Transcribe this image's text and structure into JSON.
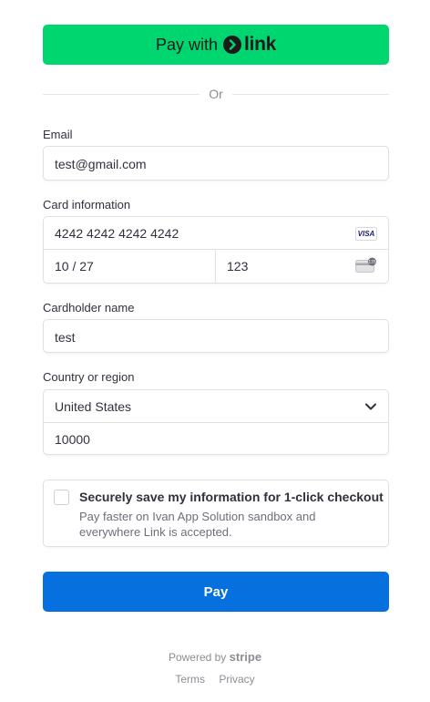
{
  "link_button": {
    "prefix": "Pay with",
    "brand": "link",
    "background": "#00d66f"
  },
  "divider_text": "Or",
  "email": {
    "label": "Email",
    "value": "test@gmail.com"
  },
  "card": {
    "label": "Card information",
    "number": "4242 4242 4242 4242",
    "brand_icon": "visa-icon",
    "brand_text": "VISA",
    "expiry": "10 / 27",
    "cvc": "123",
    "cvc_icon": "cvc-card-icon",
    "cvc_icon_text": "135"
  },
  "cardholder": {
    "label": "Cardholder name",
    "value": "test"
  },
  "country": {
    "label": "Country or region",
    "selected": "United States",
    "postal_code": "10000"
  },
  "save_info": {
    "title": "Securely save my information for 1-click checkout",
    "description": "Pay faster on Ivan App Solution sandbox and everywhere Link is accepted.",
    "checked": false
  },
  "pay_button": {
    "label": "Pay",
    "background": "#0570de"
  },
  "footer": {
    "powered_prefix": "Powered by",
    "powered_brand": "stripe",
    "terms": "Terms",
    "privacy": "Privacy"
  }
}
